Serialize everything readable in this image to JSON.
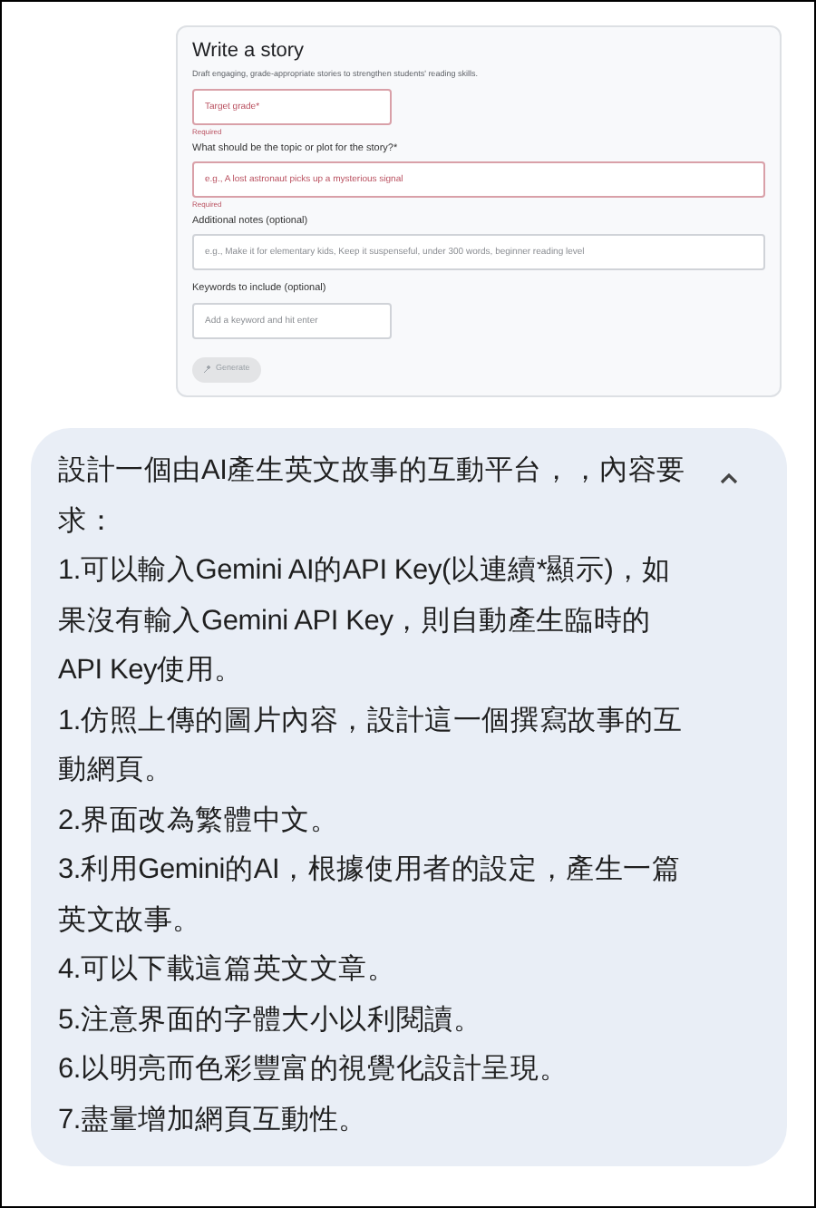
{
  "screenshot": {
    "title": "Write a story",
    "subtitle": "Draft engaging, grade-appropriate stories to strengthen students' reading skills.",
    "fields": [
      {
        "kind": "short",
        "placeholder": "Target grade*",
        "error": true,
        "helper": "Required"
      },
      {
        "kind": "wide",
        "label": "What should be the topic or plot for the story?*",
        "placeholder": "e.g., A lost astronaut picks up a mysterious signal",
        "error": true,
        "helper": "Required"
      },
      {
        "kind": "wide",
        "label": "Additional notes (optional)",
        "placeholder": "e.g., Make it for elementary kids, Keep it suspenseful, under 300 words, beginner reading level",
        "error": false
      },
      {
        "kind": "short",
        "label": "Keywords to include (optional)",
        "placeholder": "Add a keyword and hit enter",
        "error": false
      }
    ],
    "button": {
      "label": "Generate",
      "disabled": true
    }
  },
  "message": {
    "expanded": true,
    "paragraphs": [
      "設計一個由AI產生英文故事的互動平台，，內容要求：",
      "1.可以輸入Gemini AI的API Key(以連續*顯示)，如果沒有輸入Gemini API Key，則自動產生臨時的API Key使用。",
      "1.仿照上傳的圖片內容，設計這一個撰寫故事的互動網頁。",
      "2.界面改為繁體中文。",
      "3.利用Gemini的AI，根據使用者的設定，產生一篇英文故事。",
      "4.可以下載這篇英文文章。",
      "5.注意界面的字體大小以利閱讀。",
      "6.以明亮而色彩豐富的視覺化設計呈現。",
      "7.盡量增加網頁互動性。"
    ]
  }
}
